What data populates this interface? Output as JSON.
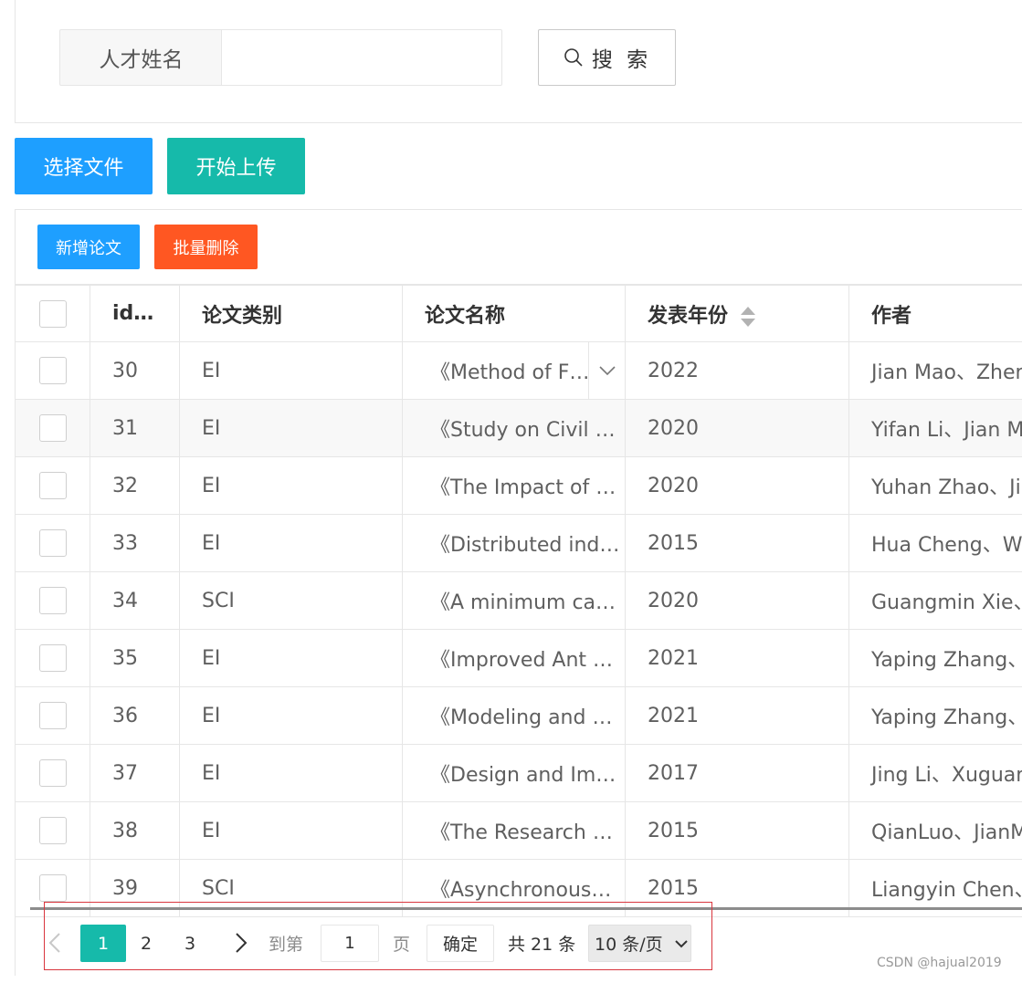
{
  "search": {
    "label": "人才姓名",
    "value": "",
    "placeholder": "",
    "button_label": "搜 索"
  },
  "upload": {
    "select_label": "选择文件",
    "upload_label": "开始上传"
  },
  "toolbar": {
    "add_label": "新增论文",
    "batch_delete_label": "批量删除"
  },
  "table": {
    "columns": [
      "id…",
      "论文类别",
      "论文名称",
      "发表年份",
      "作者"
    ],
    "rows": [
      {
        "id": "30",
        "category": "EI",
        "title": "《Method of Flig…",
        "year": "2022",
        "author": "Jian Mao、Zhen"
      },
      {
        "id": "31",
        "category": "EI",
        "title": "《Study on Civil …",
        "year": "2020",
        "author": "Yifan Li、Jian M"
      },
      {
        "id": "32",
        "category": "EI",
        "title": "《The Impact of …",
        "year": "2020",
        "author": "Yuhan Zhao、Ji…"
      },
      {
        "id": "33",
        "category": "EI",
        "title": "《Distributed ind…",
        "year": "2015",
        "author": "Hua Cheng、We"
      },
      {
        "id": "34",
        "category": "SCI",
        "title": "《A minimum ca…",
        "year": "2020",
        "author": "Guangmin Xie、"
      },
      {
        "id": "35",
        "category": "EI",
        "title": "《Improved Ant …",
        "year": "2021",
        "author": "Yaping Zhang、"
      },
      {
        "id": "36",
        "category": "EI",
        "title": "《Modeling and …",
        "year": "2021",
        "author": "Yaping Zhang、"
      },
      {
        "id": "37",
        "category": "EI",
        "title": "《Design and Im…",
        "year": "2017",
        "author": "Jing Li、Xuguan"
      },
      {
        "id": "38",
        "category": "EI",
        "title": "《The Research …",
        "year": "2015",
        "author": "QianLuo、JianM"
      },
      {
        "id": "39",
        "category": "SCI",
        "title": "《Asynchronous…",
        "year": "2015",
        "author": "Liangyin Chen、"
      }
    ]
  },
  "pager": {
    "current": "1",
    "pages": [
      "2",
      "3"
    ],
    "goto_label": "到第",
    "goto_value": "1",
    "page_unit": "页",
    "confirm_label": "确定",
    "total_text": "共 21 条",
    "page_size": "10 条/页"
  },
  "watermark": "CSDN @hajual2019",
  "colors": {
    "primary_blue": "#1e9fff",
    "teal": "#16baaa",
    "danger_orange": "#ff5722",
    "highlight_frame": "#d9363e"
  }
}
